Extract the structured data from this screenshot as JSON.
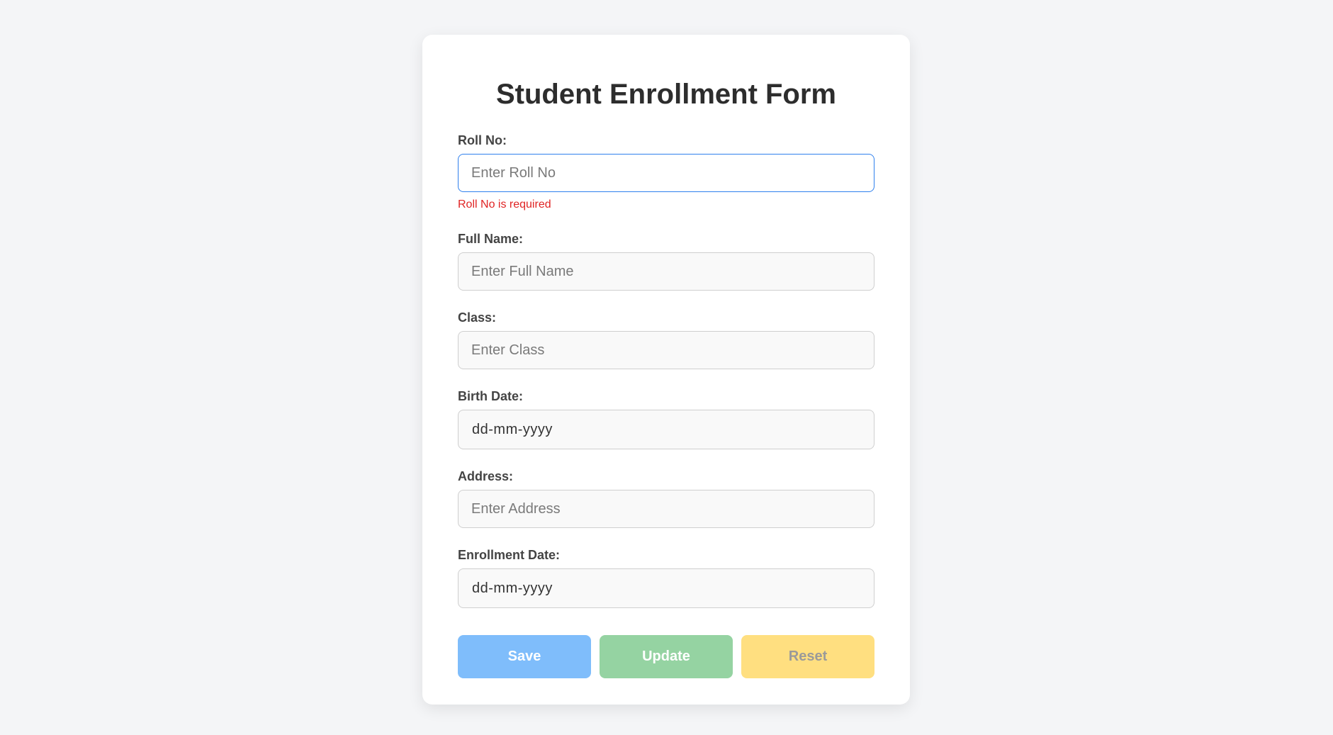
{
  "form": {
    "title": "Student Enrollment Form",
    "fields": {
      "roll_no": {
        "label": "Roll No:",
        "placeholder": "Enter Roll No",
        "value": "",
        "error": "Roll No is required"
      },
      "full_name": {
        "label": "Full Name:",
        "placeholder": "Enter Full Name",
        "value": ""
      },
      "class": {
        "label": "Class:",
        "placeholder": "Enter Class",
        "value": ""
      },
      "birth_date": {
        "label": "Birth Date:",
        "display": "dd-mm-yyyy"
      },
      "address": {
        "label": "Address:",
        "placeholder": "Enter Address",
        "value": ""
      },
      "enrollment_date": {
        "label": "Enrollment Date:",
        "display": "dd-mm-yyyy"
      }
    },
    "buttons": {
      "save": "Save",
      "update": "Update",
      "reset": "Reset"
    }
  },
  "colors": {
    "page_background": "#f4f5f7",
    "focus_border": "#2f80ed",
    "error_text": "#e02424",
    "save_button": "#7fbdfb",
    "update_button": "#95d3a2",
    "reset_button": "#ffdf80"
  }
}
